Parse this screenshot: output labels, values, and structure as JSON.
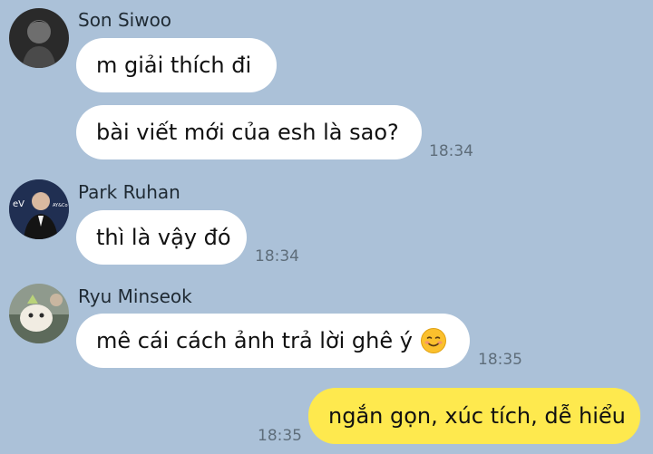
{
  "colors": {
    "background": "#abc1d8",
    "incoming_bubble": "#ffffff",
    "outgoing_bubble": "#fee94e",
    "timestamp": "#5e6d7a"
  },
  "messages": [
    {
      "sender": "Son Siwoo",
      "texts": [
        "m giải thích đi",
        "bài viết mới của esh là sao?"
      ],
      "time": "18:34"
    },
    {
      "sender": "Park Ruhan",
      "texts": [
        "thì là vậy đó"
      ],
      "time": "18:34"
    },
    {
      "sender": "Ryu Minseok",
      "texts": [
        "mê cái cách ảnh trả lời ghê ý"
      ],
      "emoji": "smiling-face-icon",
      "time": "18:35"
    },
    {
      "sender": "me",
      "texts": [
        "ngắn gọn, xúc tích, dễ hiểu"
      ],
      "time": "18:35"
    }
  ]
}
